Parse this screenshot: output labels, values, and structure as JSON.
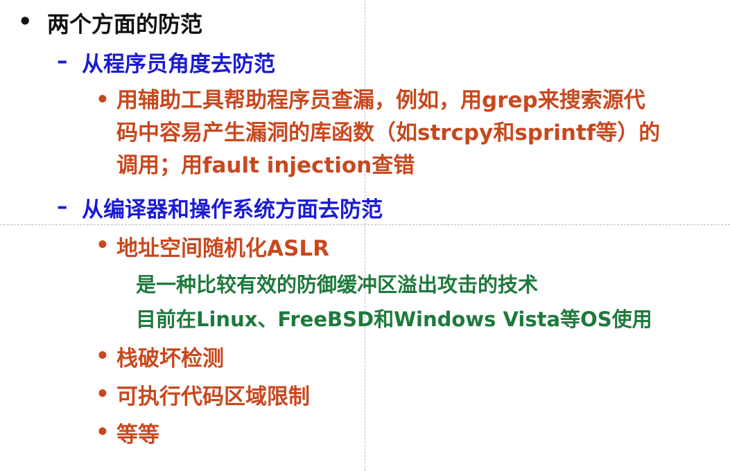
{
  "slide": {
    "level1_bullet": "•",
    "level2_marker": "–",
    "level3_bullet": "•",
    "title": "两个方面的防范",
    "section1": "从程序员角度去防范",
    "section1_item_lines": [
      "用辅助工具帮助程序员查漏，例如，用grep来搜索源代",
      "码中容易产生漏洞的库函数（如strcpy和sprintf等）的",
      "调用；用fault injection查错"
    ],
    "section2": "从编译器和操作系统方面去防范",
    "aslr": "地址空间随机化ASLR",
    "aslr_note1": "是一种比较有效的防御缓冲区溢出攻击的技术",
    "aslr_note2": "目前在Linux、FreeBSD和Windows Vista等OS使用",
    "item_stack": "栈破坏检测",
    "item_exec": "可执行代码区域限制",
    "item_etc": "等等"
  },
  "colors": {
    "black": "#111111",
    "blue": "#1a1ad6",
    "orange": "#c8481e",
    "green": "#1e7a3c"
  }
}
